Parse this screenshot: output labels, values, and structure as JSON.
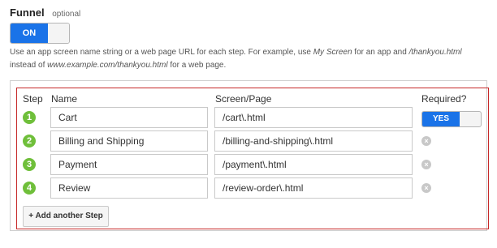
{
  "funnel": {
    "title": "Funnel",
    "optional": "optional",
    "toggle_label": "ON",
    "help_parts": [
      "Use an app screen name string or a web page URL for each step. For example, use ",
      "My Screen",
      " for an app and ",
      "/thankyou.html",
      " instead of ",
      "www.example.com/thankyou.html",
      " for a web page."
    ]
  },
  "table": {
    "headers": {
      "step": "Step",
      "name": "Name",
      "page": "Screen/Page",
      "required": "Required?"
    },
    "rows": [
      {
        "num": "1",
        "name": "Cart",
        "page": "/cart\\.html"
      },
      {
        "num": "2",
        "name": "Billing and Shipping",
        "page": "/billing-and-shipping\\.html"
      },
      {
        "num": "3",
        "name": "Payment",
        "page": "/payment\\.html"
      },
      {
        "num": "4",
        "name": "Review",
        "page": "/review-order\\.html"
      }
    ],
    "required_label": "YES",
    "remove_icon": "remove-icon",
    "add_step_label": "+ Add another Step"
  },
  "colors": {
    "accent": "#1a73e8",
    "step": "#6fbf3a",
    "border_highlight": "#c62828"
  }
}
